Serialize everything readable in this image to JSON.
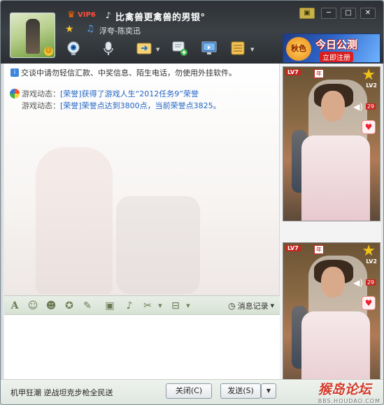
{
  "header": {
    "vip_label": "VIP6",
    "nickname": "比禽兽更禽兽的男银°",
    "status_text": "浮夸-陈奕迅",
    "window_buttons": [
      "▣",
      "─",
      "□",
      "✕"
    ]
  },
  "ad": {
    "brand": "秋色",
    "slogan": "今日公测",
    "cta": "立即注册"
  },
  "chat": {
    "notice": "交谈中请勿轻信汇款、中奖信息、陌生电话，勿使用外挂软件。",
    "game_rows": [
      {
        "label": "游戏动态：",
        "text": "[荣誉]获得了游戏人生“2012任务9”荣誉"
      },
      {
        "label": "游戏动态：",
        "text": "[荣誉]荣誉点达到3800点，当前荣誉点3825。"
      }
    ]
  },
  "toolbar": {
    "history_label": "消息记录"
  },
  "footer": {
    "status_text": "机甲狂潮 逆战坦克步枪全民送",
    "close_label": "关闭(C)",
    "send_label": "发送(S)"
  },
  "videos": [
    {
      "badge": "LV7",
      "year": "年",
      "level": "LV2",
      "count": "29"
    },
    {
      "badge": "LV7",
      "year": "年",
      "level": "LV2",
      "count": "29"
    }
  ],
  "watermark": {
    "main": "猴岛论坛",
    "sub": "BBS.HOUDAO.COM"
  }
}
